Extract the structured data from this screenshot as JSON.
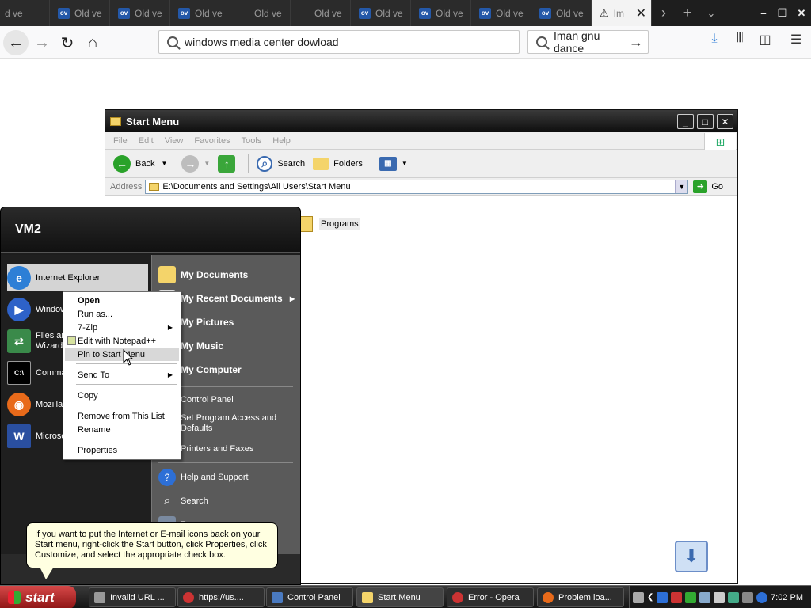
{
  "browser": {
    "tabs": [
      {
        "label": "d ve",
        "has_icon": false
      },
      {
        "label": "Old ve",
        "has_icon": true
      },
      {
        "label": "Old ve",
        "has_icon": true
      },
      {
        "label": "Old ve",
        "has_icon": true
      },
      {
        "label": "Old ve",
        "has_icon": false
      },
      {
        "label": "Old ve",
        "has_icon": false
      },
      {
        "label": "Old ve",
        "has_icon": true
      },
      {
        "label": "Old ve",
        "has_icon": true
      },
      {
        "label": "Old ve",
        "has_icon": true
      },
      {
        "label": "Old ve",
        "has_icon": true
      }
    ],
    "active_tab_label": "Im",
    "icon_text": "ov",
    "url": "windows media center dowload",
    "search": "Iman gnu dance"
  },
  "explorer": {
    "title": "Start Menu",
    "menu": [
      "File",
      "Edit",
      "View",
      "Favorites",
      "Tools",
      "Help"
    ],
    "toolbar": {
      "back": "Back",
      "search": "Search",
      "folders": "Folders"
    },
    "address_label": "Address",
    "address": "E:\\Documents and Settings\\All Users\\Start Menu",
    "go": "Go",
    "folder": "Programs"
  },
  "start_menu": {
    "user": "VM2",
    "left_items": [
      {
        "label": "Internet Explorer"
      },
      {
        "label": "Window"
      },
      {
        "label": "Files ar",
        "label2": "Wizard"
      },
      {
        "label": "Comma"
      },
      {
        "label": "Mozilla"
      },
      {
        "label": "Microso"
      }
    ],
    "right_items": {
      "my_documents": "My Documents",
      "my_recent": "My Recent Documents",
      "my_pictures": "My Pictures",
      "my_music": "My Music",
      "my_computer": "My Computer",
      "control_panel": "Control Panel",
      "program_access_1": "Set Program Access and",
      "program_access_2": "Defaults",
      "printers": "Printers and Faxes",
      "help": "Help and Support",
      "search": "Search",
      "run": "R"
    }
  },
  "context_menu": {
    "open": "Open",
    "run_as": "Run as...",
    "zip": "7-Zip",
    "notepad": "Edit with Notepad++",
    "pin": "Pin to Start Menu",
    "send_to": "Send To",
    "copy": "Copy",
    "remove": "Remove from This List",
    "rename": "Rename",
    "properties": "Properties"
  },
  "balloon": "If you want to put the Internet or E-mail icons back on your Start menu, right-click the Start button, click Properties, click Customize, and select the appropriate check box.",
  "taskbar": {
    "start": "start",
    "items": [
      {
        "label": "Invalid URL ..."
      },
      {
        "label": "https://us...."
      },
      {
        "label": "Control Panel"
      },
      {
        "label": "Start Menu"
      },
      {
        "label": "Error - Opera"
      },
      {
        "label": "Problem loa..."
      }
    ],
    "clock": "7:02 PM"
  }
}
